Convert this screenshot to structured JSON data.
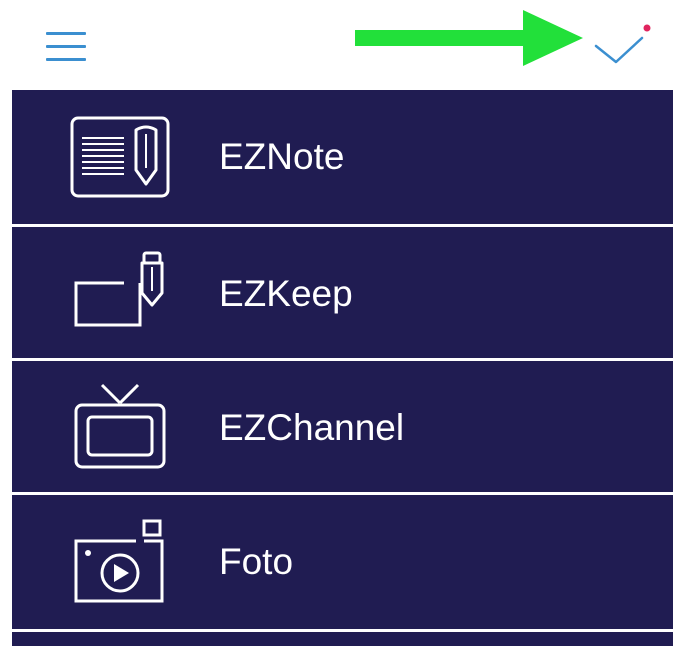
{
  "header": {
    "menu_icon": "hamburger-menu-icon",
    "pointer": "green-arrow-pointer",
    "confirm_icon": "checkmark-icon",
    "badge_color": "#e0245e",
    "accent_color": "#3b8fd0",
    "arrow_color": "#22e03a"
  },
  "menu": {
    "background_color": "#201c52",
    "items": [
      {
        "label": "EZNote",
        "icon": "note-pencil-icon"
      },
      {
        "label": "EZKeep",
        "icon": "keep-pencil-icon"
      },
      {
        "label": "EZChannel",
        "icon": "tv-icon"
      },
      {
        "label": "Foto",
        "icon": "photo-camera-icon"
      }
    ]
  }
}
